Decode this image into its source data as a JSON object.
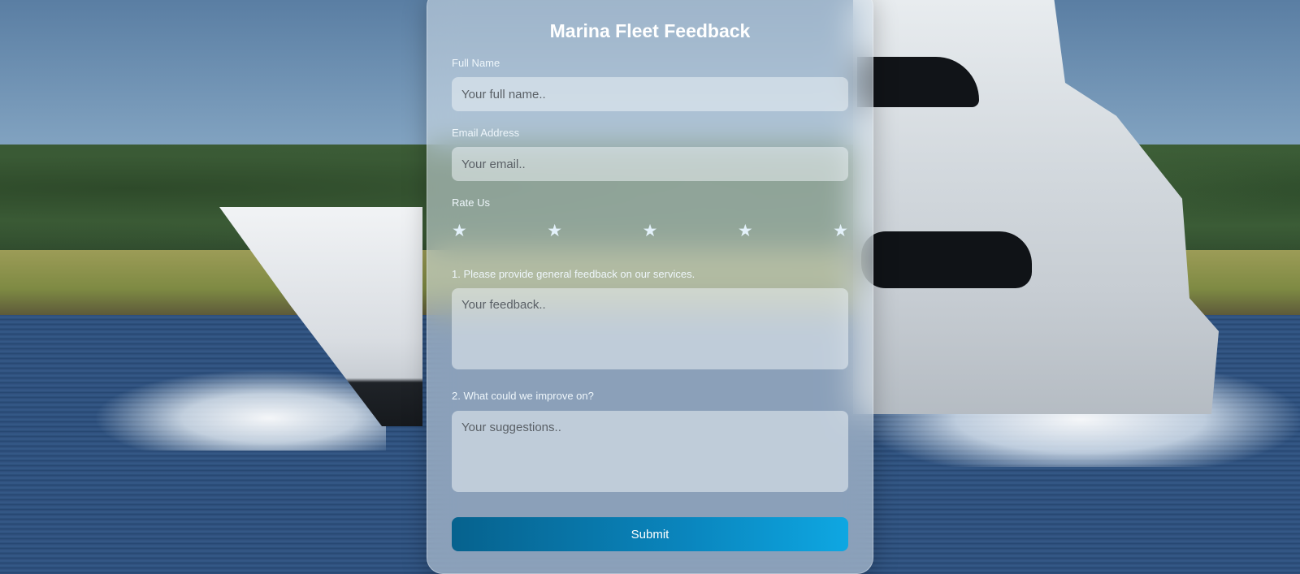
{
  "form": {
    "title": "Marina Fleet Feedback",
    "full_name_label": "Full Name",
    "full_name_placeholder": "Your full name..",
    "full_name_value": "",
    "email_label": "Email Address",
    "email_placeholder": "Your email..",
    "email_value": "",
    "rating_label": "Rate Us",
    "rating": {
      "star_glyph": "★",
      "max": 5,
      "selected": 0
    },
    "q1_label": "1. Please provide general feedback on our services.",
    "q1_placeholder": "Your feedback..",
    "q2_label": "2. What could we improve on?",
    "q2_placeholder": "Your suggestions..",
    "submit_label": "Submit"
  },
  "colors": {
    "submit_gradient_start": "#06628e",
    "submit_gradient_end": "#0ea7e2",
    "star_color": "#e3f1fa",
    "title_color": "#ffffff"
  }
}
